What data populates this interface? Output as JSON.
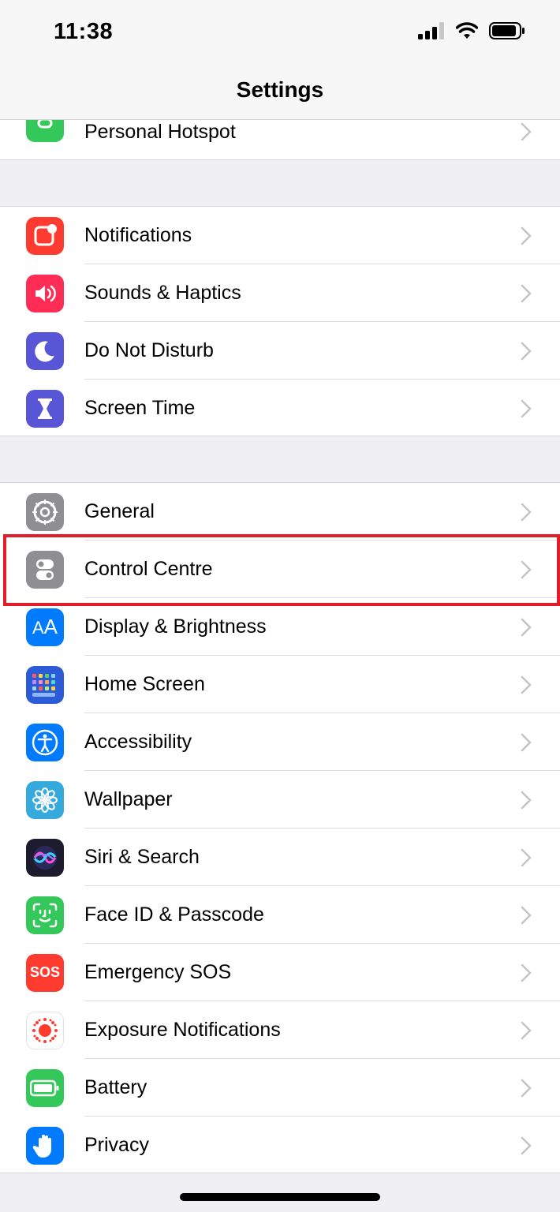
{
  "status_bar": {
    "time": "11:38",
    "icons": [
      "cellular-signal-icon",
      "wifi-icon",
      "battery-icon"
    ]
  },
  "nav": {
    "title": "Settings"
  },
  "groups": [
    {
      "items": [
        {
          "label": "Personal Hotspot",
          "icon": "personal-hotspot-icon",
          "color": "#34c759"
        }
      ]
    },
    {
      "items": [
        {
          "label": "Notifications",
          "icon": "notifications-icon",
          "color": "#ff3b30"
        },
        {
          "label": "Sounds & Haptics",
          "icon": "speaker-icon",
          "color": "#ff2d55"
        },
        {
          "label": "Do Not Disturb",
          "icon": "moon-icon",
          "color": "#5856d6"
        },
        {
          "label": "Screen Time",
          "icon": "hourglass-icon",
          "color": "#5856d6"
        }
      ]
    },
    {
      "items": [
        {
          "label": "General",
          "icon": "gear-icon",
          "color": "#8e8e93"
        },
        {
          "label": "Control Centre",
          "icon": "toggles-icon",
          "color": "#8e8e93",
          "highlighted": true
        },
        {
          "label": "Display & Brightness",
          "icon": "text-size-icon",
          "color": "#007aff"
        },
        {
          "label": "Home Screen",
          "icon": "app-grid-icon",
          "color": "#2c5bd8"
        },
        {
          "label": "Accessibility",
          "icon": "accessibility-icon",
          "color": "#007aff"
        },
        {
          "label": "Wallpaper",
          "icon": "flower-icon",
          "color": "#36aadc"
        },
        {
          "label": "Siri & Search",
          "icon": "siri-icon",
          "color": "#1c1c2e"
        },
        {
          "label": "Face ID & Passcode",
          "icon": "face-id-icon",
          "color": "#34c759"
        },
        {
          "label": "Emergency SOS",
          "icon": "sos-icon",
          "color": "#ff3b30",
          "icon_text": "SOS"
        },
        {
          "label": "Exposure Notifications",
          "icon": "exposure-icon",
          "color": "#ffffff"
        },
        {
          "label": "Battery",
          "icon": "battery-setting-icon",
          "color": "#34c759"
        },
        {
          "label": "Privacy",
          "icon": "hand-icon",
          "color": "#007aff"
        }
      ]
    }
  ],
  "colors": {
    "highlight": "#e11d2a",
    "chevron": "#c4c4c7",
    "background": "#efeff4"
  }
}
